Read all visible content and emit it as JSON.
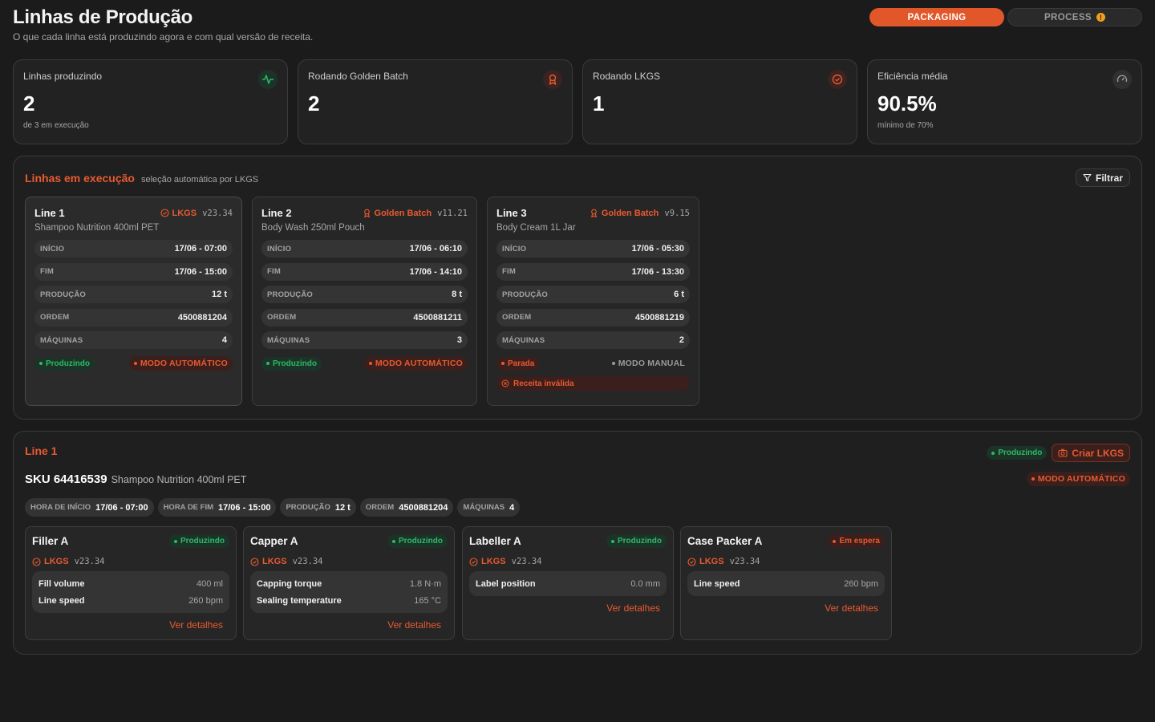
{
  "header": {
    "title": "Linhas de Produção",
    "subtitle": "O que cada linha está produzindo agora e com qual versão de receita."
  },
  "tabs": [
    {
      "label": "PACKAGING",
      "active": true
    },
    {
      "label": "PROCESS",
      "active": false,
      "warning_icon": "!"
    }
  ],
  "kpis": [
    {
      "label": "Linhas produzindo",
      "value": "2",
      "sub": "de 3 em execução",
      "icon": "activity-icon"
    },
    {
      "label": "Rodando Golden Batch",
      "value": "2",
      "sub": "",
      "icon": "award-icon"
    },
    {
      "label": "Rodando LKGS",
      "value": "1",
      "sub": "",
      "icon": "check-badge-icon"
    },
    {
      "label": "Eficiência média",
      "value": "90.5%",
      "sub": "mínimo de 70%",
      "icon": "gauge-icon"
    }
  ],
  "running": {
    "title": "Linhas em execução",
    "note": "seleção automática por LKGS",
    "filter_label": "Filtrar",
    "lines": [
      {
        "name": "Line 1",
        "recipe": "LKGS",
        "version": "v23.34",
        "product": "Shampoo Nutrition 400ml PET",
        "rows": [
          {
            "label": "INÍCIO",
            "value": "17/06 - 07:00"
          },
          {
            "label": "FIM",
            "value": "17/06 - 15:00"
          },
          {
            "label": "PRODUÇÃO",
            "value": "12 t"
          },
          {
            "label": "ORDEM",
            "value": "4500881204"
          },
          {
            "label": "MÁQUINAS",
            "value": "4"
          }
        ],
        "status": "Produzindo",
        "mode": "MODO AUTOMÁTICO"
      },
      {
        "name": "Line 2",
        "recipe": "Golden Batch",
        "version": "v11.21",
        "product": "Body Wash 250ml Pouch",
        "rows": [
          {
            "label": "INÍCIO",
            "value": "17/06 - 06:10"
          },
          {
            "label": "FIM",
            "value": "17/06 - 14:10"
          },
          {
            "label": "PRODUÇÃO",
            "value": "8 t"
          },
          {
            "label": "ORDEM",
            "value": "4500881211"
          },
          {
            "label": "MÁQUINAS",
            "value": "3"
          }
        ],
        "status": "Produzindo",
        "mode": "MODO AUTOMÁTICO"
      },
      {
        "name": "Line 3",
        "recipe": "Golden Batch",
        "version": "v9.15",
        "product": "Body Cream 1L Jar",
        "rows": [
          {
            "label": "INÍCIO",
            "value": "17/06 - 05:30"
          },
          {
            "label": "FIM",
            "value": "17/06 - 13:30"
          },
          {
            "label": "PRODUÇÃO",
            "value": "6 t"
          },
          {
            "label": "ORDEM",
            "value": "4500881219"
          },
          {
            "label": "MÁQUINAS",
            "value": "2"
          }
        ],
        "status": "Parada",
        "mode": "MODO MANUAL",
        "warning": "Receita inválida"
      }
    ]
  },
  "detail": {
    "title": "Line 1",
    "status": "Produzindo",
    "create_label": "Criar LKGS",
    "mode": "MODO AUTOMÁTICO",
    "sku_code": "SKU 64416539",
    "sku_name": "Shampoo Nutrition 400ml PET",
    "chips": [
      {
        "label": "HORA DE INÍCIO",
        "value": "17/06 - 07:00"
      },
      {
        "label": "HORA DE FIM",
        "value": "17/06 - 15:00"
      },
      {
        "label": "PRODUÇÃO",
        "value": "12 t"
      },
      {
        "label": "ORDEM",
        "value": "4500881204"
      },
      {
        "label": "MÁQUINAS",
        "value": "4"
      }
    ],
    "machines": [
      {
        "name": "Filler A",
        "status": "Produzindo",
        "recipe": "LKGS",
        "version": "v23.34",
        "params": [
          {
            "label": "Fill volume",
            "value": "400 ml"
          },
          {
            "label": "Line speed",
            "value": "260 bpm"
          }
        ],
        "link": "Ver detalhes"
      },
      {
        "name": "Capper A",
        "status": "Produzindo",
        "recipe": "LKGS",
        "version": "v23.34",
        "params": [
          {
            "label": "Capping torque",
            "value": "1.8 N·m"
          },
          {
            "label": "Sealing temperature",
            "value": "165 °C"
          }
        ],
        "link": "Ver detalhes"
      },
      {
        "name": "Labeller A",
        "status": "Produzindo",
        "recipe": "LKGS",
        "version": "v23.34",
        "params": [
          {
            "label": "Label position",
            "value": "0.0 mm"
          }
        ],
        "link": "Ver detalhes"
      },
      {
        "name": "Case Packer A",
        "status": "Em espera",
        "recipe": "LKGS",
        "version": "v23.34",
        "params": [
          {
            "label": "Line speed",
            "value": "260 bpm"
          }
        ],
        "link": "Ver detalhes"
      }
    ]
  },
  "colors": {
    "accent": "#e85a30",
    "success": "#2fb86a",
    "background": "#1b1b1b"
  }
}
